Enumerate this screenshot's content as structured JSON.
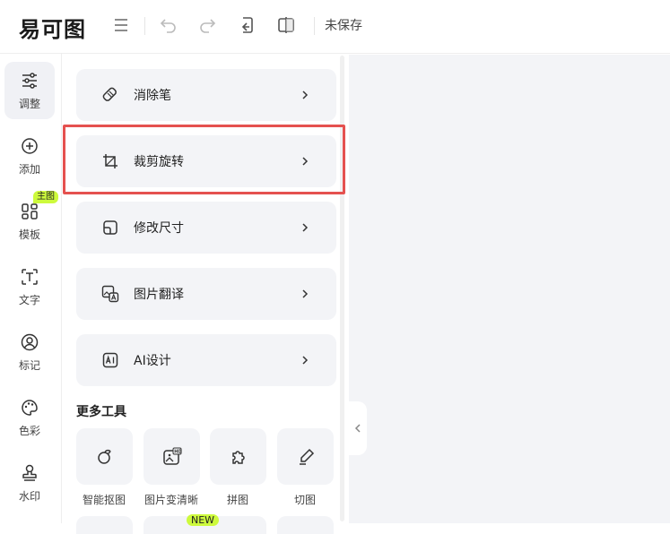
{
  "app": {
    "logo": "易可图",
    "status": "未保存"
  },
  "toolbar": {
    "icons": [
      "menu-icon",
      "undo-icon",
      "redo-icon",
      "restore-icon",
      "compare-icon"
    ]
  },
  "rail": {
    "items": [
      {
        "label": "调整",
        "icon": "sliders-icon",
        "active": true
      },
      {
        "label": "添加",
        "icon": "plus-circle-icon"
      },
      {
        "label": "模板",
        "icon": "grid-icon",
        "badge": "主图"
      },
      {
        "label": "文字",
        "icon": "text-icon"
      },
      {
        "label": "标记",
        "icon": "person-circle-icon"
      },
      {
        "label": "色彩",
        "icon": "palette-icon"
      },
      {
        "label": "水印",
        "icon": "stamp-icon"
      }
    ]
  },
  "panel": {
    "tools": [
      {
        "label": "消除笔",
        "icon": "eraser-icon"
      },
      {
        "label": "裁剪旋转",
        "icon": "crop-icon"
      },
      {
        "label": "修改尺寸",
        "icon": "resize-icon"
      },
      {
        "label": "图片翻译",
        "icon": "image-translate-icon"
      },
      {
        "label": "AI设计",
        "icon": "ai-icon"
      }
    ],
    "more_title": "更多工具",
    "more_tools": [
      {
        "label": "智能抠图",
        "icon": "cutout-icon"
      },
      {
        "label": "图片变清晰",
        "icon": "hd-image-icon"
      },
      {
        "label": "拼图",
        "icon": "puzzle-icon"
      },
      {
        "label": "切图",
        "icon": "slice-icon"
      }
    ],
    "new_badge": "NEW"
  },
  "colors": {
    "highlight": "#e5514f",
    "badge": "#cdfa3c",
    "card_bg": "#f3f4f7"
  }
}
